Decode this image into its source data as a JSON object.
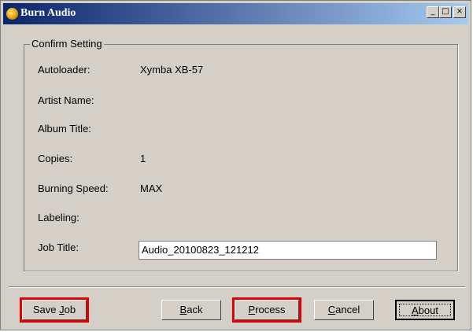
{
  "window": {
    "title": "Burn Audio"
  },
  "title_buttons": {
    "minimize": "_",
    "maximize": "□",
    "close": "×"
  },
  "group": {
    "legend": "Confirm Setting"
  },
  "fields": [
    {
      "label": "Autoloader:",
      "value": "Xymba XB-57"
    },
    {
      "label": "Artist Name:",
      "value": ""
    },
    {
      "label": "Album Title:",
      "value": ""
    },
    {
      "label": "Copies:",
      "value": "1"
    },
    {
      "label": "Burning Speed:",
      "value": "MAX"
    },
    {
      "label": "Labeling:",
      "value": ""
    }
  ],
  "job": {
    "label": "Job Title:",
    "value": "Audio_20100823_121212"
  },
  "buttons": {
    "save_job_pre": "Save ",
    "save_job_u": "J",
    "save_job_post": "ob",
    "back_u": "B",
    "back_post": "ack",
    "process_u": "P",
    "process_post": "rocess",
    "cancel_u": "C",
    "cancel_post": "ancel",
    "about_u": "A",
    "about_post": "bout"
  },
  "colors": {
    "highlight": "#e00000",
    "titlebar": "#0a246a",
    "face": "#d4d0c8"
  }
}
